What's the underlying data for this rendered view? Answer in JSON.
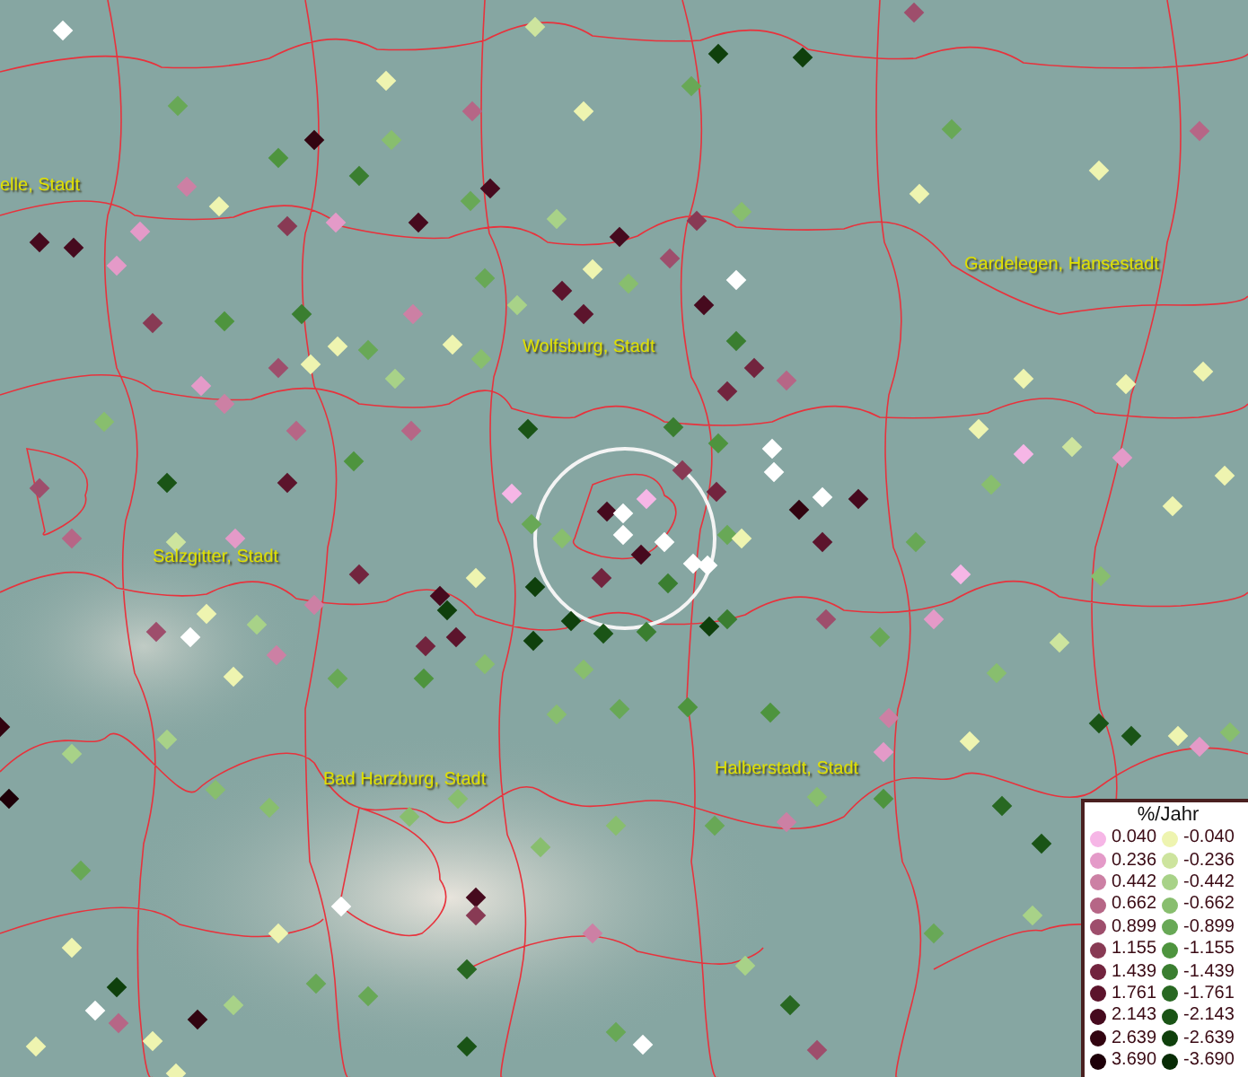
{
  "map": {
    "place_labels": [
      "elle, Stadt",
      "Wolfsburg, Stadt",
      "Gardelegen, Hansestadt",
      "Salzgitter, Stadt",
      "Bad Harzburg, Stadt",
      "Halberstadt, Stadt"
    ]
  },
  "legend": {
    "title": "%/Jahr",
    "positive": [
      {
        "value": "0.040",
        "color": "#f6b6e6"
      },
      {
        "value": "0.236",
        "color": "#e49ac8"
      },
      {
        "value": "0.442",
        "color": "#cc80a4"
      },
      {
        "value": "0.662",
        "color": "#b66686"
      },
      {
        "value": "0.899",
        "color": "#9e4e6c"
      },
      {
        "value": "1.155",
        "color": "#883a54"
      },
      {
        "value": "1.439",
        "color": "#72243e"
      },
      {
        "value": "1.761",
        "color": "#5c142c"
      },
      {
        "value": "2.143",
        "color": "#460a1e"
      },
      {
        "value": "2.639",
        "color": "#320410"
      },
      {
        "value": "3.690",
        "color": "#1e0008"
      }
    ],
    "negative": [
      {
        "value": "-0.040",
        "color": "#eef4b0"
      },
      {
        "value": "-0.236",
        "color": "#cde49e"
      },
      {
        "value": "-0.442",
        "color": "#a8d288"
      },
      {
        "value": "-0.662",
        "color": "#88be6e"
      },
      {
        "value": "-0.899",
        "color": "#68a856"
      },
      {
        "value": "-1.155",
        "color": "#4e943e"
      },
      {
        "value": "-1.439",
        "color": "#3a7e30"
      },
      {
        "value": "-1.761",
        "color": "#286822"
      },
      {
        "value": "-2.143",
        "color": "#1a5416"
      },
      {
        "value": "-2.639",
        "color": "#0f400c"
      },
      {
        "value": "-3.690",
        "color": "#082c06"
      }
    ]
  }
}
